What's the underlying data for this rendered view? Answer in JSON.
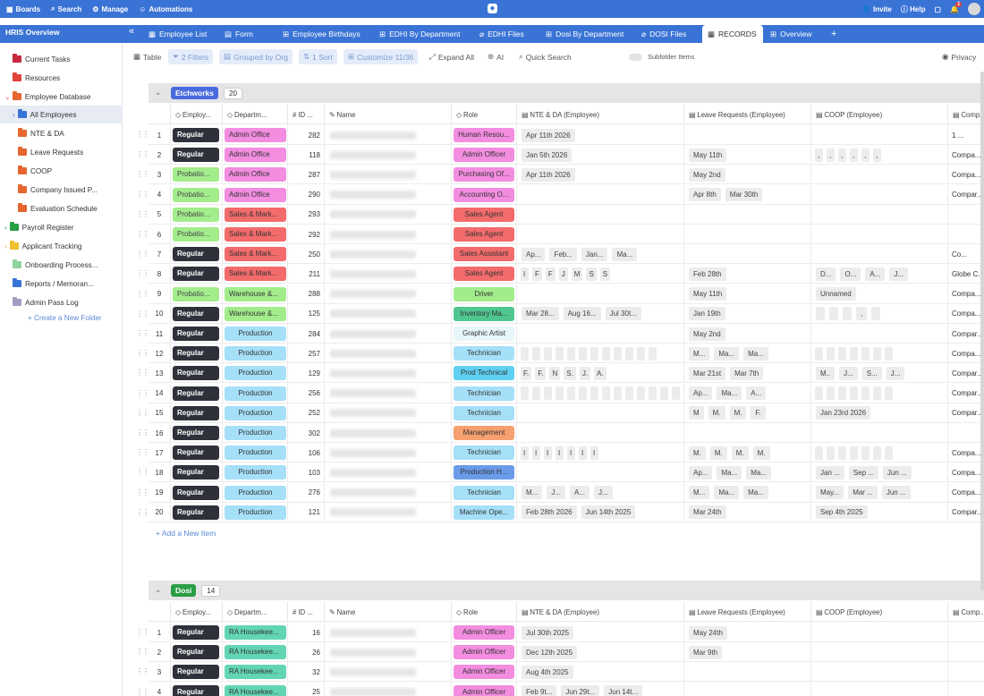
{
  "topbar": {
    "boards": "Boards",
    "search": "Search",
    "manage": "Manage",
    "automations": "Automations",
    "invite": "Invite",
    "help": "Help",
    "notif_count": "1"
  },
  "workspace": "HRIS Overview",
  "tabs": [
    "Employee List",
    "Form",
    "Employee Birthdays",
    "EDHI By Department",
    "EDHI Files",
    "Dosi By Department",
    "DOSI Files",
    "RECORDS",
    "Overview"
  ],
  "sidebar": [
    "Current Tasks",
    "Resources",
    "Employee Database",
    "All Employees",
    "NTE & DA",
    "Leave Requests",
    "COOP",
    "Company Issued P...",
    "Evaluation Schedule",
    "Payroll Register",
    "Applicant Tracking",
    "Onboarding Process...",
    "Reports / Memoran...",
    "Admin Pass Log",
    "+ Create a New Folder"
  ],
  "toolbar": {
    "table": "Table",
    "filters": "2 Filters",
    "group": "Grouped by Org",
    "sort": "1 Sort",
    "customize": "Customize 11/36",
    "expand": "Expand All",
    "ai": "AI",
    "quick_search": "Quick Search",
    "subfolder": "Subfolder Items",
    "privacy": "Privacy"
  },
  "columns": [
    "Employ...",
    "Departm...",
    "ID ...",
    "Name",
    "Role",
    "NTE & DA (Employee)",
    "Leave Requests (Employee)",
    "COOP (Employee)",
    "Comp..."
  ],
  "add_new": "+ Add a New Item",
  "colors": {
    "accent": "#3a73d6",
    "etchworks": "#4a6bde",
    "dosi": "#2a9d45",
    "regular": "#2e3139",
    "probation": "#a3ec8c"
  },
  "groups": [
    {
      "name": "Etchworks",
      "count": "20",
      "rows": [
        {
          "n": "1",
          "emp": "Regular",
          "dept": "Admin Office",
          "id": "282",
          "role": "Human Resou...",
          "nte": [
            "Apr 11th 2026"
          ],
          "leave": [],
          "coop": [],
          "comp": "1 ..."
        },
        {
          "n": "2",
          "emp": "Regular",
          "dept": "Admin Office",
          "id": "118",
          "role": "Admin Officer",
          "nte": [
            "Jan 5th 2026"
          ],
          "leave": [
            "May 11th"
          ],
          "coop": [
            ",",
            ",",
            ",",
            ",",
            ",",
            ","
          ],
          "comp": "Compa..."
        },
        {
          "n": "3",
          "emp": "Probatio...",
          "dept": "Admin Office",
          "id": "287",
          "role": "Purchasing Of...",
          "nte": [
            "Apr 11th 2026"
          ],
          "leave": [
            "May 2nd"
          ],
          "coop": [],
          "comp": "Compa..."
        },
        {
          "n": "4",
          "emp": "Probatio...",
          "dept": "Admin Office",
          "id": "290",
          "role": "Accounting O...",
          "nte": [],
          "leave": [
            "Apr 8th",
            "Mar 30th"
          ],
          "coop": [],
          "comp": "Compar..."
        },
        {
          "n": "5",
          "emp": "Probatio...",
          "dept": "Sales & Mark...",
          "id": "293",
          "role": "Sales Agent",
          "nte": [],
          "leave": [],
          "coop": [],
          "comp": ""
        },
        {
          "n": "6",
          "emp": "Probatio...",
          "dept": "Sales & Mark...",
          "id": "292",
          "role": "Sales Agent",
          "nte": [],
          "leave": [],
          "coop": [],
          "comp": ""
        },
        {
          "n": "7",
          "emp": "Regular",
          "dept": "Sales & Mark...",
          "id": "250",
          "role": "Sales Assistant",
          "nte": [
            "Ap...",
            "Feb...",
            "Jan...",
            "Ma..."
          ],
          "leave": [],
          "coop": [],
          "comp": "Co..."
        },
        {
          "n": "8",
          "emp": "Regular",
          "dept": "Sales & Mark...",
          "id": "211",
          "role": "Sales Agent",
          "nte": [
            "I",
            "F",
            "F",
            "J",
            "M",
            "S",
            "S"
          ],
          "leave": [
            "Feb 28th"
          ],
          "coop": [
            "D...",
            "O...",
            "A...",
            "J..."
          ],
          "comp": "Globe C..."
        },
        {
          "n": "9",
          "emp": "Probatio...",
          "dept": "Warehouse &...",
          "id": "288",
          "role": "Driver",
          "nte": [],
          "leave": [
            "May 11th"
          ],
          "coop": [
            "Unnamed"
          ],
          "comp": "Compa..."
        },
        {
          "n": "10",
          "emp": "Regular",
          "dept": "Warehouse &...",
          "id": "125",
          "role": "Inventory Ma...",
          "nte": [
            "Mar 28...",
            "Aug 16...",
            "Jul 30t..."
          ],
          "leave": [
            "Jan 19th"
          ],
          "coop": [
            "",
            "",
            "",
            ",",
            ""
          ],
          "comp": "Compa..."
        },
        {
          "n": "11",
          "emp": "Regular",
          "dept": "Production",
          "id": "284",
          "role": "Graphic Artist",
          "nte": [],
          "leave": [
            "May 2nd"
          ],
          "coop": [],
          "comp": "Compar..."
        },
        {
          "n": "12",
          "emp": "Regular",
          "dept": "Production",
          "id": "257",
          "role": "Technician",
          "nte": [
            "",
            "",
            "",
            "",
            "",
            "",
            "",
            "",
            "",
            "",
            "",
            ""
          ],
          "leave": [
            "M...",
            "Ma...",
            "Ma..."
          ],
          "coop": [
            "",
            "",
            "",
            "",
            "",
            "",
            ""
          ],
          "comp": "Compa..."
        },
        {
          "n": "13",
          "emp": "Regular",
          "dept": "Production",
          "id": "129",
          "role": "Prod Technical",
          "nte": [
            "F.",
            "F.",
            "N",
            "S.",
            "J.",
            "A."
          ],
          "leave": [
            "Mar 21st",
            "Mar 7th"
          ],
          "coop": [
            "M..",
            "J...",
            "S...",
            "J..."
          ],
          "comp": "Compar..."
        },
        {
          "n": "14",
          "emp": "Regular",
          "dept": "Production",
          "id": "256",
          "role": "Technician",
          "nte": [
            "",
            "",
            "",
            "",
            "",
            "",
            "",
            "",
            "",
            "",
            "",
            "",
            "",
            ""
          ],
          "leave": [
            "Ap...",
            "Ma...",
            "A..."
          ],
          "coop": [
            "",
            "",
            "",
            "",
            "",
            "",
            ""
          ],
          "comp": "Compar..."
        },
        {
          "n": "15",
          "emp": "Regular",
          "dept": "Production",
          "id": "252",
          "role": "Technician",
          "nte": [],
          "leave": [
            "M",
            "M.",
            "M.",
            "F."
          ],
          "coop": [
            "Jan 23rd 2026"
          ],
          "comp": "Compar..."
        },
        {
          "n": "16",
          "emp": "Regular",
          "dept": "Production",
          "id": "302",
          "role": "Management",
          "nte": [],
          "leave": [],
          "coop": [],
          "comp": ""
        },
        {
          "n": "17",
          "emp": "Regular",
          "dept": "Production",
          "id": "106",
          "role": "Technician",
          "nte": [
            "I",
            "I",
            "I",
            "I",
            "I",
            "I",
            "I"
          ],
          "leave": [
            "M.",
            "M.",
            "M.",
            "M."
          ],
          "coop": [
            "",
            "",
            "",
            "",
            "",
            "",
            ""
          ],
          "comp": "Compa..."
        },
        {
          "n": "18",
          "emp": "Regular",
          "dept": "Production",
          "id": "103",
          "role": "Production H...",
          "nte": [],
          "leave": [
            "Ap...",
            "Ma...",
            "Ma..."
          ],
          "coop": [
            "Jan ...",
            "Sep ...",
            "Jun ..."
          ],
          "comp": "Compa..."
        },
        {
          "n": "19",
          "emp": "Regular",
          "dept": "Production",
          "id": "276",
          "role": "Technician",
          "nte": [
            "M...",
            "J...",
            "A...",
            "J..."
          ],
          "leave": [
            "M...",
            "Ma...",
            "Ma..."
          ],
          "coop": [
            "May...",
            "Mar ...",
            "Jun ..."
          ],
          "comp": "Compa..."
        },
        {
          "n": "20",
          "emp": "Regular",
          "dept": "Production",
          "id": "121",
          "role": "Machine Ope...",
          "nte": [
            "Feb 28th 2026",
            "Jun 14th 2025"
          ],
          "leave": [
            "Mar 24th"
          ],
          "coop": [
            "Sep 4th 2025"
          ],
          "comp": "Compar..."
        }
      ]
    },
    {
      "name": "Dosi",
      "count": "14",
      "rows": [
        {
          "n": "1",
          "emp": "Regular",
          "dept": "RA Housekee...",
          "id": "16",
          "role": "Admin Officer",
          "nte": [
            "Jul 30th 2025"
          ],
          "leave": [
            "May 24th"
          ],
          "coop": [],
          "comp": ""
        },
        {
          "n": "2",
          "emp": "Regular",
          "dept": "RA Housekee...",
          "id": "26",
          "role": "Admin Officer",
          "nte": [
            "Dec 12th 2025"
          ],
          "leave": [
            "Mar 9th"
          ],
          "coop": [],
          "comp": ""
        },
        {
          "n": "3",
          "emp": "Regular",
          "dept": "RA Housekee...",
          "id": "32",
          "role": "Admin Officer",
          "nte": [
            "Aug 4th 2025"
          ],
          "leave": [],
          "coop": [],
          "comp": ""
        },
        {
          "n": "4",
          "emp": "Regular",
          "dept": "RA Housekee...",
          "id": "25",
          "role": "Admin Officer",
          "nte": [
            "Feb 9t...",
            "Jun 29t...",
            "Jun 14t..."
          ],
          "leave": [],
          "coop": [],
          "comp": ""
        }
      ]
    }
  ]
}
